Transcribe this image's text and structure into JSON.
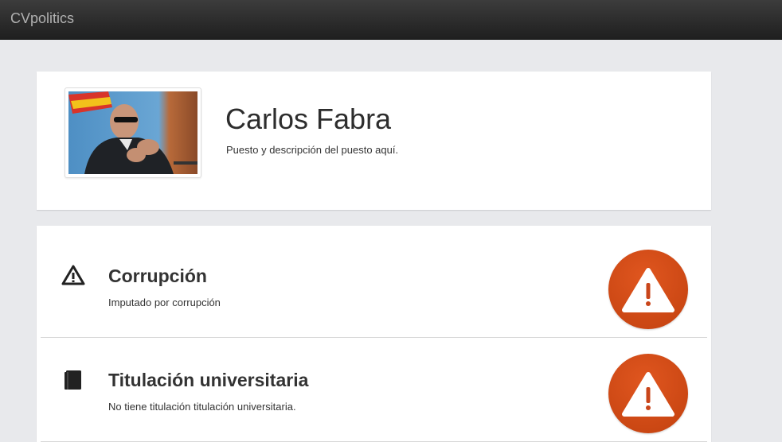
{
  "app": {
    "brand": "CVpolitics"
  },
  "profile": {
    "name": "Carlos Fabra",
    "role": "Puesto y descripción del puesto aquí."
  },
  "items": [
    {
      "icon": "warning-triangle-icon",
      "title": "Corrupción",
      "description": "Imputado por corrupción",
      "badge_icon": "alert-icon"
    },
    {
      "icon": "book-icon",
      "title": "Titulación universitaria",
      "description": "No tiene titulación titulación universitaria.",
      "badge_icon": "alert-icon"
    }
  ],
  "colors": {
    "navbar": "#2a2a2a",
    "alert": "#d2491a",
    "background": "#e8e9ec"
  }
}
